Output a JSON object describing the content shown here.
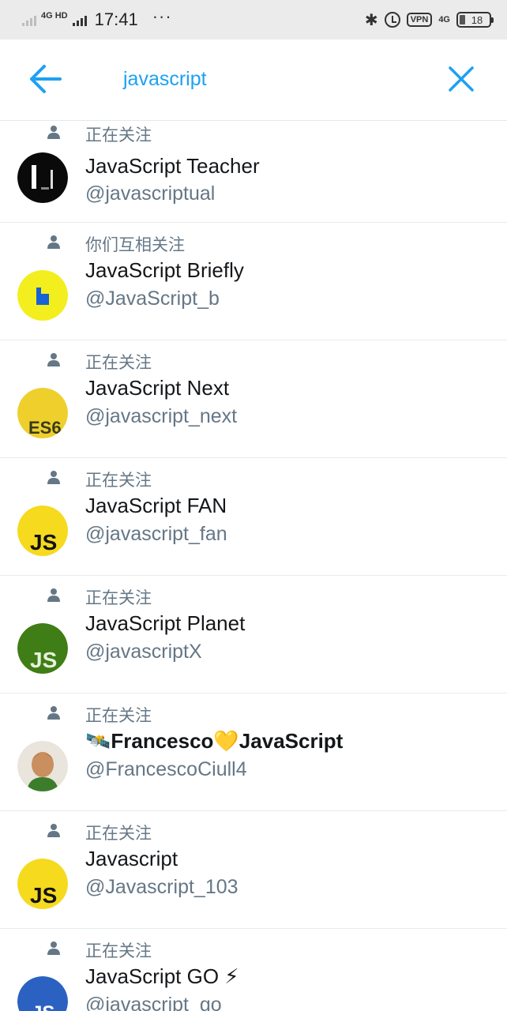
{
  "status_bar": {
    "network": "4G HD",
    "time": "17:41",
    "dots": "···",
    "vpn": "VPN",
    "net_right": "4G",
    "battery": "18"
  },
  "header": {
    "search_query": "javascript"
  },
  "results": [
    {
      "follow_status": "正在关注",
      "name": "JavaScript Teacher",
      "handle": "@javascriptual",
      "avatar": "black-avatar"
    },
    {
      "follow_status": "你们互相关注",
      "name": "JavaScript Briefly",
      "handle": "@JavaScript_b",
      "avatar": "yellow-b-avatar"
    },
    {
      "follow_status": "正在关注",
      "name": "JavaScript Next",
      "handle": "@javascript_next",
      "avatar": "es6-avatar"
    },
    {
      "follow_status": "正在关注",
      "name": "JavaScript FAN",
      "handle": "@javascript_fan",
      "avatar": "js-yellow-avatar"
    },
    {
      "follow_status": "正在关注",
      "name": "JavaScript Planet",
      "handle": "@javascriptX",
      "avatar": "js-green-avatar"
    },
    {
      "follow_status": "正在关注",
      "name": "🛰️Francesco💛JavaScript",
      "handle": "@FrancescoCiull4",
      "avatar": "photo-avatar"
    },
    {
      "follow_status": "正在关注",
      "name": "Javascript",
      "handle": "@Javascript_103",
      "avatar": "js-yellow-avatar"
    },
    {
      "follow_status": "正在关注",
      "name": "JavaScript GO ⚡",
      "handle": "@javascript_go",
      "avatar": "js-blue-avatar"
    }
  ],
  "colors": {
    "accent": "#1da1f2",
    "secondary_text": "#657786",
    "divider": "#e6ecf0"
  }
}
